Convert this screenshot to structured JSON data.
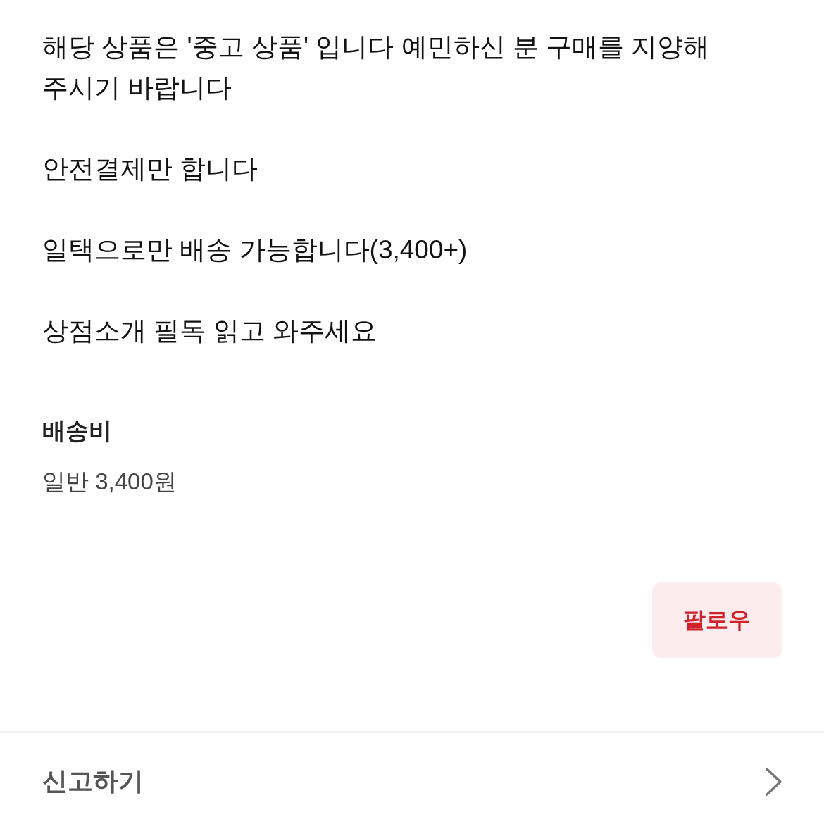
{
  "description": {
    "paragraphs": [
      "해당 상품은 '중고 상품' 입니다 예민하신 분 구매를 지양해 주시기 바랍니다",
      "안전결제만 합니다",
      "일택으로만 배송 가능합니다(3,400+)",
      "상점소개 필독 읽고 와주세요"
    ]
  },
  "shipping": {
    "title": "배송비",
    "value": "일반 3,400원"
  },
  "follow_button": {
    "label": "팔로우"
  },
  "report_row": {
    "label": "신고하기"
  }
}
